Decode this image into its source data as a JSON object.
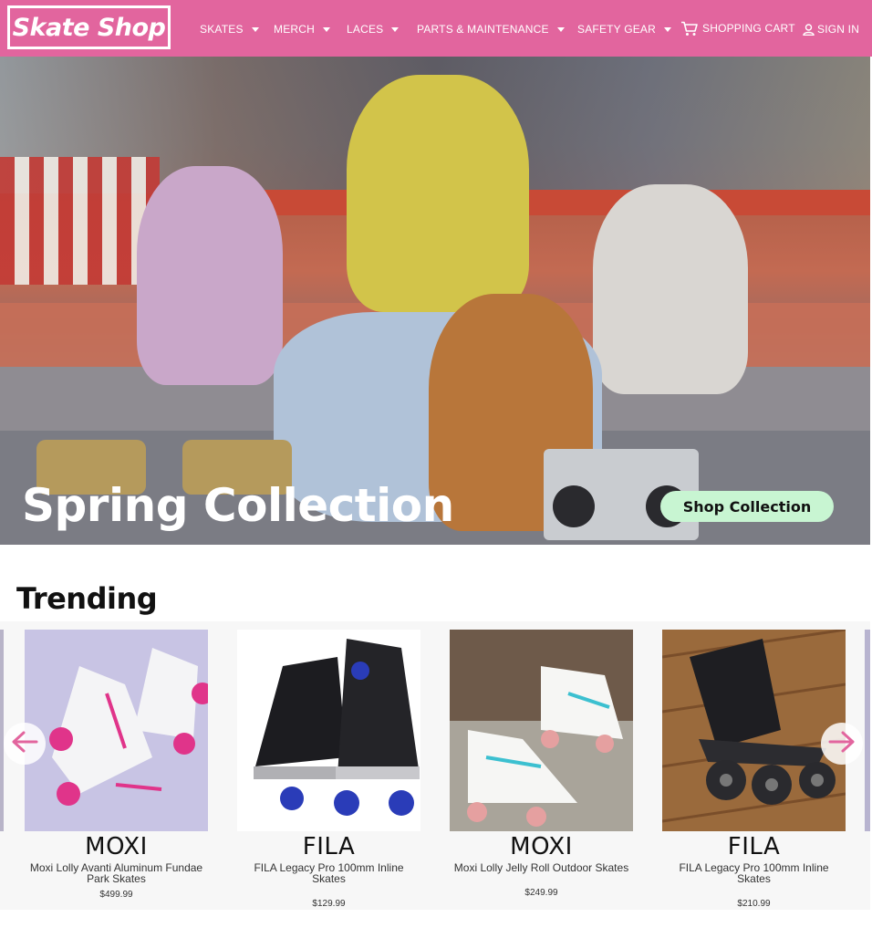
{
  "nav": {
    "logo": "Skate Shop",
    "items": [
      {
        "label": "SKATES"
      },
      {
        "label": "MERCH"
      },
      {
        "label": "LACES"
      },
      {
        "label": "PARTS & MAINTENANCE"
      },
      {
        "label": "SAFETY GEAR"
      }
    ],
    "cart_label": "SHOPPING CART",
    "signin_label": "SIGN IN"
  },
  "hero": {
    "title": "Spring Collection",
    "button_label": "Shop Collection"
  },
  "trending": {
    "title": "Trending",
    "products": [
      {
        "brand": "MOXI",
        "name": "Moxi Lolly Avanti Aluminum Fundae Park Skates",
        "price": "$499.99"
      },
      {
        "brand": "FILA",
        "name": "FILA Legacy Pro 100mm Inline Skates",
        "price": "$129.99"
      },
      {
        "brand": "MOXI",
        "name": "Moxi Lolly Jelly Roll Outdoor Skates",
        "price": "$249.99"
      },
      {
        "brand": "FILA",
        "name": "FILA Legacy Pro 100mm Inline Skates",
        "price": "$210.99"
      }
    ]
  },
  "colors": {
    "brand_pink": "#e2659e",
    "cta_mint": "#c8f5d2",
    "arrow_pink": "#e2659e"
  }
}
